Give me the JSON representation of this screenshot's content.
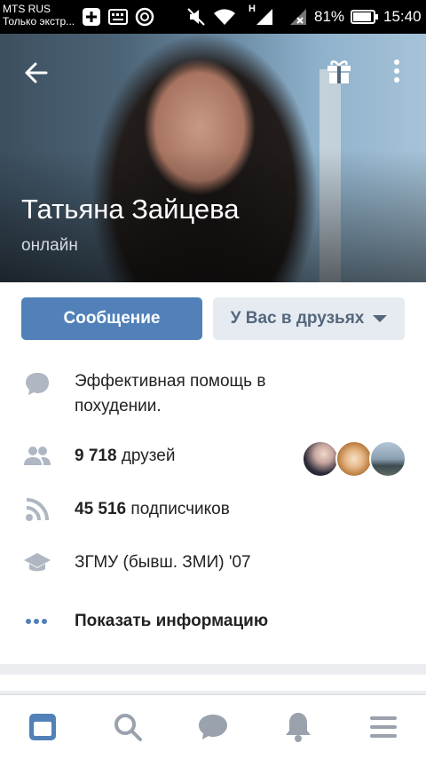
{
  "status_bar": {
    "carrier": "MTS RUS",
    "carrier_sub": "Только экстр...",
    "network_label": "H",
    "battery": "81%",
    "time": "15:40"
  },
  "profile": {
    "name": "Татьяна Зайцева",
    "status": "онлайн",
    "message_button": "Сообщение",
    "friends_button": "У Вас в друзьях"
  },
  "info": {
    "description": "Эффективная помощь в похудении.",
    "friends_count": "9 718",
    "friends_label": "друзей",
    "followers_count": "45 516",
    "followers_label": "подписчиков",
    "education": "ЗГМУ (бывш. ЗМИ) '07",
    "show_info": "Показать информацию"
  },
  "icons": {
    "back": "arrow-left-icon",
    "gift": "gift-icon",
    "more": "more-vertical-icon",
    "description": "speech-bubble-icon",
    "friends": "people-icon",
    "followers": "rss-icon",
    "education": "graduation-cap-icon",
    "show_info": "dots-icon",
    "nav": [
      "news-icon",
      "search-icon",
      "messages-icon",
      "notifications-icon",
      "menu-icon"
    ]
  },
  "colors": {
    "accent": "#5181b8",
    "link": "#2a5885",
    "icon_gray": "#aeb7c2",
    "nav_active": "#5181b8"
  }
}
